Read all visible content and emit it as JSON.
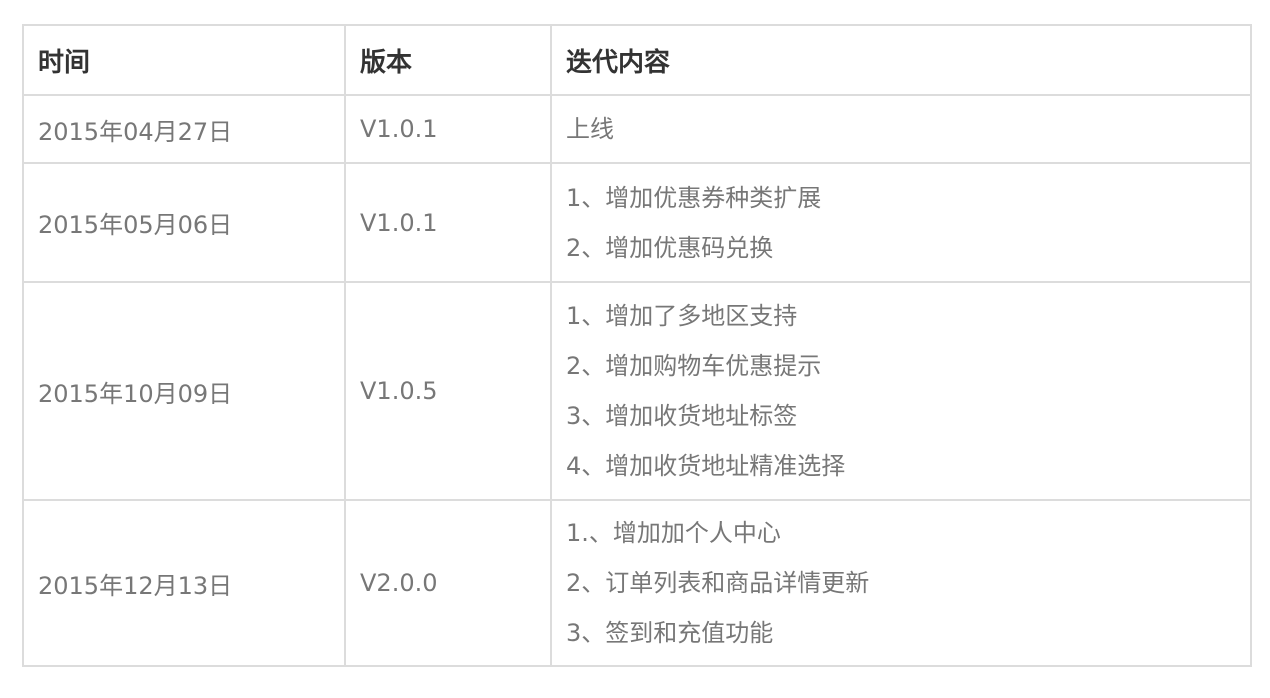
{
  "table": {
    "headers": {
      "date": "时间",
      "version": "版本",
      "content": "迭代内容"
    },
    "rows": [
      {
        "date": "2015年04月27日",
        "version": "V1.0.1",
        "items": [
          "上线"
        ]
      },
      {
        "date": "2015年05月06日",
        "version": "V1.0.1",
        "items": [
          "1、增加优惠券种类扩展",
          "2、增加优惠码兑换"
        ]
      },
      {
        "date": "2015年10月09日",
        "version": "V1.0.5",
        "items": [
          "1、增加了多地区支持",
          "2、增加购物车优惠提示",
          "3、增加收货地址标签",
          "4、增加收货地址精准选择"
        ]
      },
      {
        "date": "2015年12月13日",
        "version": "V2.0.0",
        "items": [
          "1.、增加加个人中心",
          "2、订单列表和商品详情更新",
          "3、签到和充值功能"
        ]
      }
    ]
  }
}
